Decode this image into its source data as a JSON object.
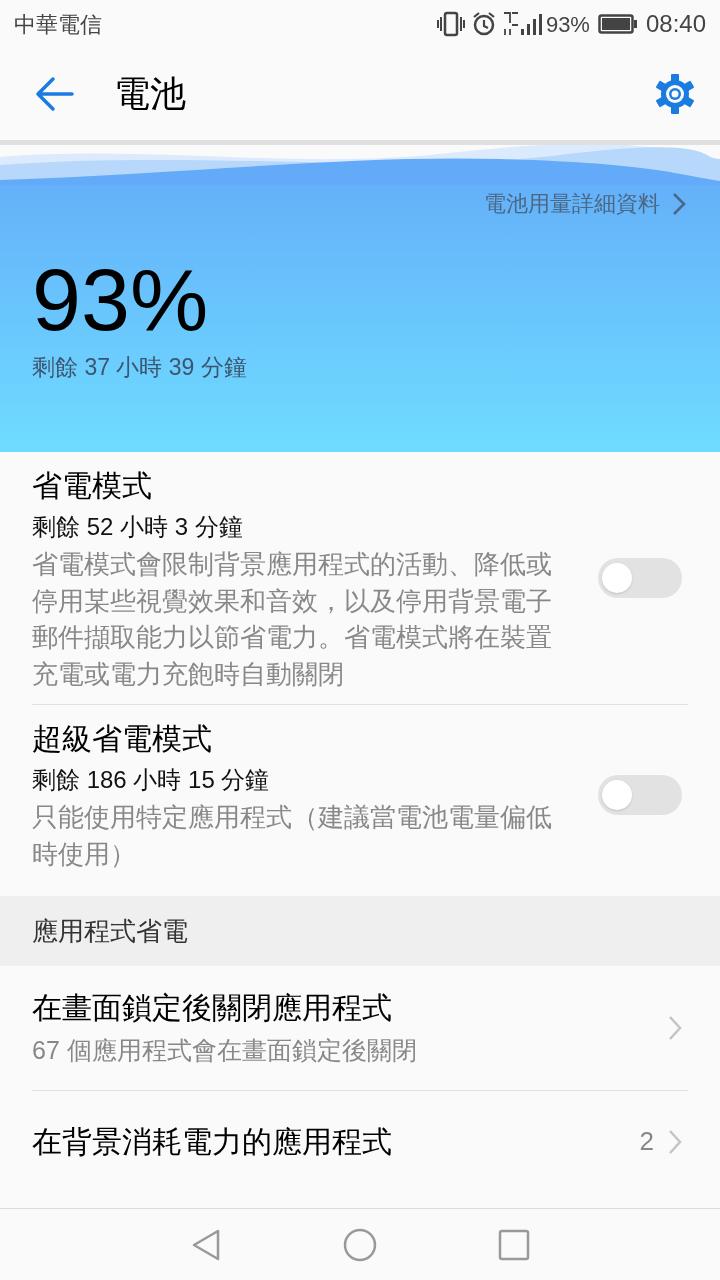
{
  "status_bar": {
    "carrier": "中華電信",
    "battery_percent": "93%",
    "time": "08:40"
  },
  "header": {
    "title": "電池"
  },
  "battery": {
    "details_link": "電池用量詳細資料",
    "percent": "93%",
    "remaining": "剩餘 37 小時 39 分鐘"
  },
  "modes": [
    {
      "title": "省電模式",
      "remaining": "剩餘 52 小時 3 分鐘",
      "description": "省電模式會限制背景應用程式的活動、降低或停用某些視覺效果和音效，以及停用背景電子郵件擷取能力以節省電力。省電模式將在裝置充電或電力充飽時自動關閉",
      "on": false
    },
    {
      "title": "超級省電模式",
      "remaining": "剩餘 186 小時 15 分鐘",
      "description": "只能使用特定應用程式（建議當電池電量偏低時使用）",
      "on": false
    }
  ],
  "section": {
    "title": "應用程式省電"
  },
  "items": [
    {
      "title": "在畫面鎖定後關閉應用程式",
      "subtitle": "67 個應用程式會在畫面鎖定後關閉"
    },
    {
      "title": "在背景消耗電力的應用程式",
      "count": "2"
    }
  ]
}
